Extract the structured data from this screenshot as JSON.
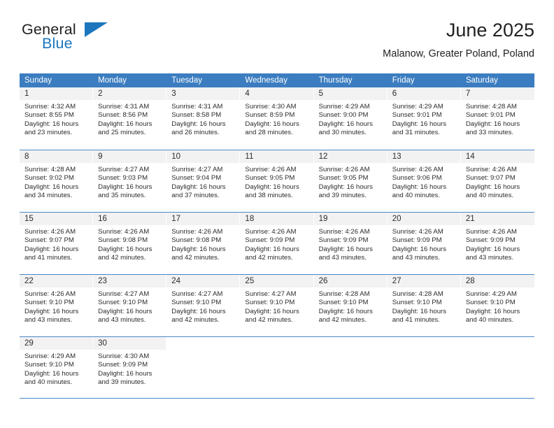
{
  "brand": {
    "name_top": "General",
    "name_bottom": "Blue",
    "accent_color": "#1b76bd"
  },
  "header": {
    "title": "June 2025",
    "subtitle": "Malanow, Greater Poland, Poland"
  },
  "theme": {
    "header_blue": "#3b7dc0",
    "daynum_band": "#f2f2f2",
    "row_rule": "#4a87c6"
  },
  "calendar": {
    "weekdays": [
      "Sunday",
      "Monday",
      "Tuesday",
      "Wednesday",
      "Thursday",
      "Friday",
      "Saturday"
    ],
    "weeks": [
      [
        {
          "day": "1",
          "sunrise": "Sunrise: 4:32 AM",
          "sunset": "Sunset: 8:55 PM",
          "daylight1": "Daylight: 16 hours",
          "daylight2": "and 23 minutes."
        },
        {
          "day": "2",
          "sunrise": "Sunrise: 4:31 AM",
          "sunset": "Sunset: 8:56 PM",
          "daylight1": "Daylight: 16 hours",
          "daylight2": "and 25 minutes."
        },
        {
          "day": "3",
          "sunrise": "Sunrise: 4:31 AM",
          "sunset": "Sunset: 8:58 PM",
          "daylight1": "Daylight: 16 hours",
          "daylight2": "and 26 minutes."
        },
        {
          "day": "4",
          "sunrise": "Sunrise: 4:30 AM",
          "sunset": "Sunset: 8:59 PM",
          "daylight1": "Daylight: 16 hours",
          "daylight2": "and 28 minutes."
        },
        {
          "day": "5",
          "sunrise": "Sunrise: 4:29 AM",
          "sunset": "Sunset: 9:00 PM",
          "daylight1": "Daylight: 16 hours",
          "daylight2": "and 30 minutes."
        },
        {
          "day": "6",
          "sunrise": "Sunrise: 4:29 AM",
          "sunset": "Sunset: 9:01 PM",
          "daylight1": "Daylight: 16 hours",
          "daylight2": "and 31 minutes."
        },
        {
          "day": "7",
          "sunrise": "Sunrise: 4:28 AM",
          "sunset": "Sunset: 9:01 PM",
          "daylight1": "Daylight: 16 hours",
          "daylight2": "and 33 minutes."
        }
      ],
      [
        {
          "day": "8",
          "sunrise": "Sunrise: 4:28 AM",
          "sunset": "Sunset: 9:02 PM",
          "daylight1": "Daylight: 16 hours",
          "daylight2": "and 34 minutes."
        },
        {
          "day": "9",
          "sunrise": "Sunrise: 4:27 AM",
          "sunset": "Sunset: 9:03 PM",
          "daylight1": "Daylight: 16 hours",
          "daylight2": "and 35 minutes."
        },
        {
          "day": "10",
          "sunrise": "Sunrise: 4:27 AM",
          "sunset": "Sunset: 9:04 PM",
          "daylight1": "Daylight: 16 hours",
          "daylight2": "and 37 minutes."
        },
        {
          "day": "11",
          "sunrise": "Sunrise: 4:26 AM",
          "sunset": "Sunset: 9:05 PM",
          "daylight1": "Daylight: 16 hours",
          "daylight2": "and 38 minutes."
        },
        {
          "day": "12",
          "sunrise": "Sunrise: 4:26 AM",
          "sunset": "Sunset: 9:05 PM",
          "daylight1": "Daylight: 16 hours",
          "daylight2": "and 39 minutes."
        },
        {
          "day": "13",
          "sunrise": "Sunrise: 4:26 AM",
          "sunset": "Sunset: 9:06 PM",
          "daylight1": "Daylight: 16 hours",
          "daylight2": "and 40 minutes."
        },
        {
          "day": "14",
          "sunrise": "Sunrise: 4:26 AM",
          "sunset": "Sunset: 9:07 PM",
          "daylight1": "Daylight: 16 hours",
          "daylight2": "and 40 minutes."
        }
      ],
      [
        {
          "day": "15",
          "sunrise": "Sunrise: 4:26 AM",
          "sunset": "Sunset: 9:07 PM",
          "daylight1": "Daylight: 16 hours",
          "daylight2": "and 41 minutes."
        },
        {
          "day": "16",
          "sunrise": "Sunrise: 4:26 AM",
          "sunset": "Sunset: 9:08 PM",
          "daylight1": "Daylight: 16 hours",
          "daylight2": "and 42 minutes."
        },
        {
          "day": "17",
          "sunrise": "Sunrise: 4:26 AM",
          "sunset": "Sunset: 9:08 PM",
          "daylight1": "Daylight: 16 hours",
          "daylight2": "and 42 minutes."
        },
        {
          "day": "18",
          "sunrise": "Sunrise: 4:26 AM",
          "sunset": "Sunset: 9:09 PM",
          "daylight1": "Daylight: 16 hours",
          "daylight2": "and 42 minutes."
        },
        {
          "day": "19",
          "sunrise": "Sunrise: 4:26 AM",
          "sunset": "Sunset: 9:09 PM",
          "daylight1": "Daylight: 16 hours",
          "daylight2": "and 43 minutes."
        },
        {
          "day": "20",
          "sunrise": "Sunrise: 4:26 AM",
          "sunset": "Sunset: 9:09 PM",
          "daylight1": "Daylight: 16 hours",
          "daylight2": "and 43 minutes."
        },
        {
          "day": "21",
          "sunrise": "Sunrise: 4:26 AM",
          "sunset": "Sunset: 9:09 PM",
          "daylight1": "Daylight: 16 hours",
          "daylight2": "and 43 minutes."
        }
      ],
      [
        {
          "day": "22",
          "sunrise": "Sunrise: 4:26 AM",
          "sunset": "Sunset: 9:10 PM",
          "daylight1": "Daylight: 16 hours",
          "daylight2": "and 43 minutes."
        },
        {
          "day": "23",
          "sunrise": "Sunrise: 4:27 AM",
          "sunset": "Sunset: 9:10 PM",
          "daylight1": "Daylight: 16 hours",
          "daylight2": "and 43 minutes."
        },
        {
          "day": "24",
          "sunrise": "Sunrise: 4:27 AM",
          "sunset": "Sunset: 9:10 PM",
          "daylight1": "Daylight: 16 hours",
          "daylight2": "and 42 minutes."
        },
        {
          "day": "25",
          "sunrise": "Sunrise: 4:27 AM",
          "sunset": "Sunset: 9:10 PM",
          "daylight1": "Daylight: 16 hours",
          "daylight2": "and 42 minutes."
        },
        {
          "day": "26",
          "sunrise": "Sunrise: 4:28 AM",
          "sunset": "Sunset: 9:10 PM",
          "daylight1": "Daylight: 16 hours",
          "daylight2": "and 42 minutes."
        },
        {
          "day": "27",
          "sunrise": "Sunrise: 4:28 AM",
          "sunset": "Sunset: 9:10 PM",
          "daylight1": "Daylight: 16 hours",
          "daylight2": "and 41 minutes."
        },
        {
          "day": "28",
          "sunrise": "Sunrise: 4:29 AM",
          "sunset": "Sunset: 9:10 PM",
          "daylight1": "Daylight: 16 hours",
          "daylight2": "and 40 minutes."
        }
      ],
      [
        {
          "day": "29",
          "sunrise": "Sunrise: 4:29 AM",
          "sunset": "Sunset: 9:10 PM",
          "daylight1": "Daylight: 16 hours",
          "daylight2": "and 40 minutes."
        },
        {
          "day": "30",
          "sunrise": "Sunrise: 4:30 AM",
          "sunset": "Sunset: 9:09 PM",
          "daylight1": "Daylight: 16 hours",
          "daylight2": "and 39 minutes."
        },
        {
          "day": "",
          "sunrise": "",
          "sunset": "",
          "daylight1": "",
          "daylight2": ""
        },
        {
          "day": "",
          "sunrise": "",
          "sunset": "",
          "daylight1": "",
          "daylight2": ""
        },
        {
          "day": "",
          "sunrise": "",
          "sunset": "",
          "daylight1": "",
          "daylight2": ""
        },
        {
          "day": "",
          "sunrise": "",
          "sunset": "",
          "daylight1": "",
          "daylight2": ""
        },
        {
          "day": "",
          "sunrise": "",
          "sunset": "",
          "daylight1": "",
          "daylight2": ""
        }
      ]
    ]
  }
}
